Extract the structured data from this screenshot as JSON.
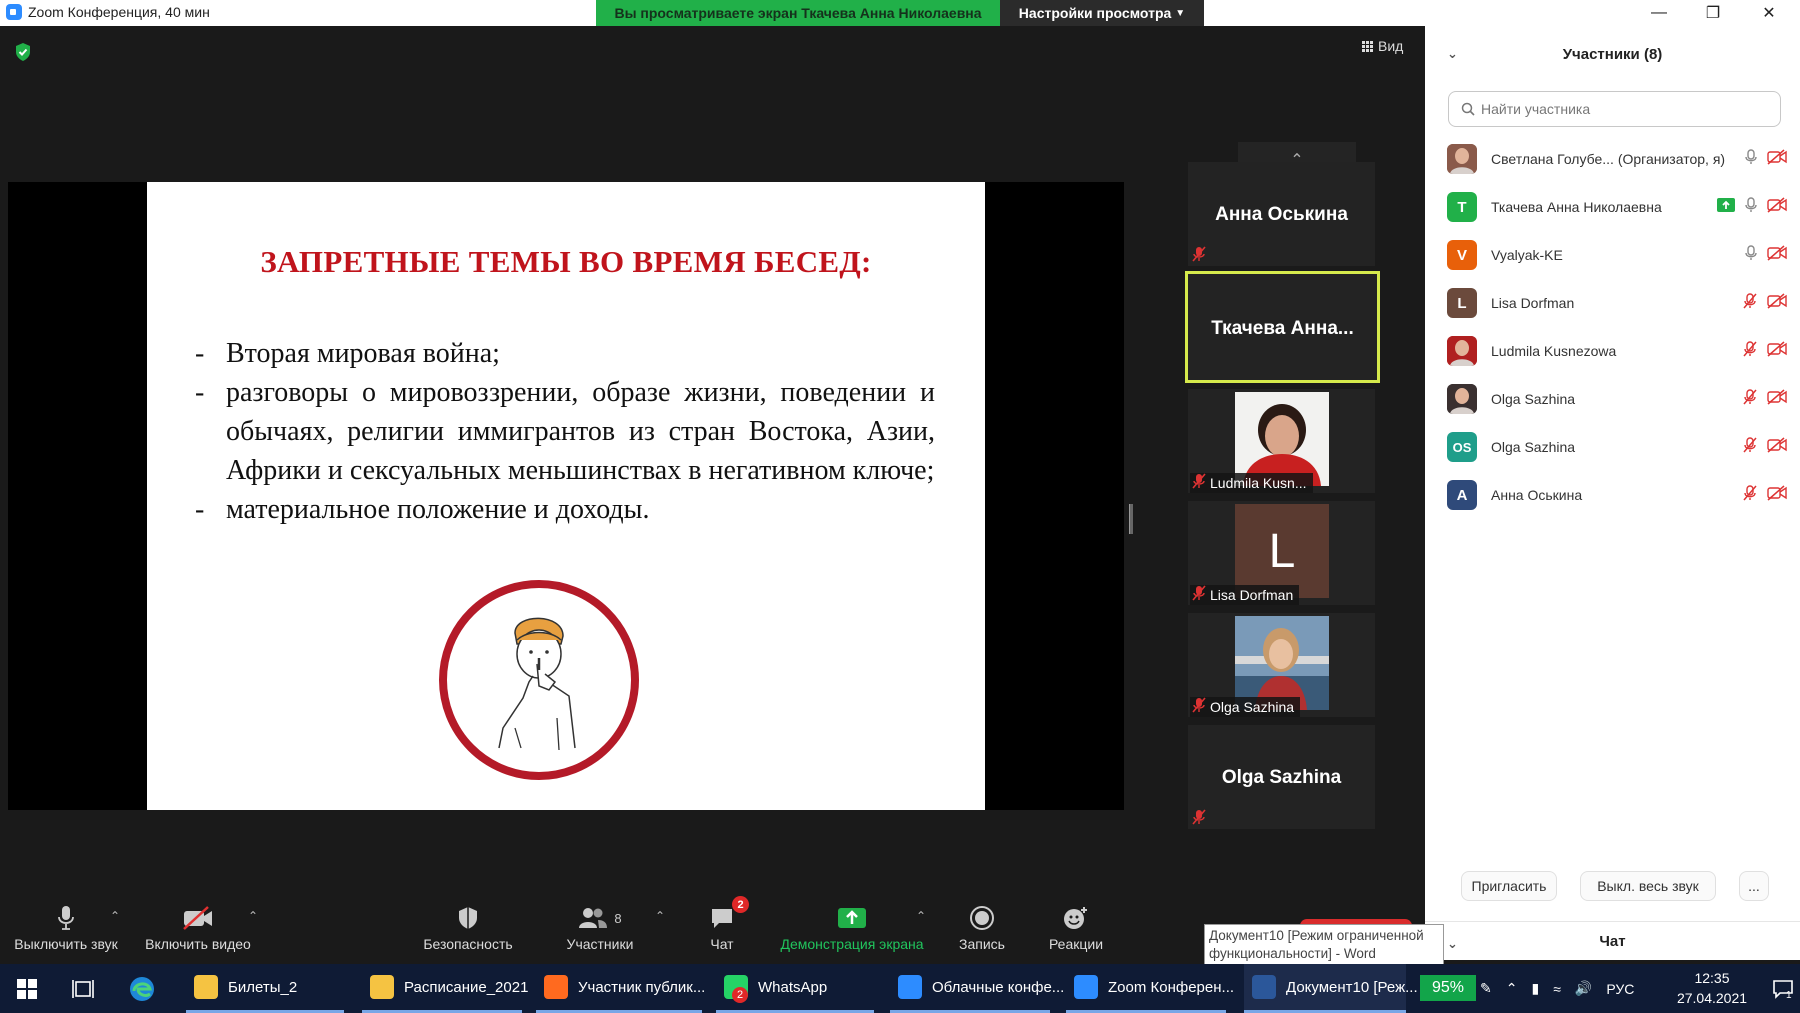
{
  "window": {
    "title": "Zoom Конференция, 40 мин",
    "viewing_banner": "Вы просматриваете экран Ткачева Анна Николаевна",
    "view_settings": "Настройки просмотра",
    "minimize": "—",
    "restore": "❐",
    "close": "✕"
  },
  "main": {
    "view_button": "Вид"
  },
  "slide": {
    "title": "ЗАПРЕТНЫЕ ТЕМЫ ВО ВРЕМЯ БЕСЕД:",
    "bullets": [
      "Вторая мировая война;",
      "разговоры о мировоззрении, образе жизни, поведении и обычаях, религии иммигрантов из стран Востока, Азии, Африки и сексуальных меньшинствах в негативном ключе;",
      "материальное положение и доходы."
    ],
    "dash": "-",
    "title_color": "#c0141c"
  },
  "thumbnails": [
    {
      "name": "Анна Оськина",
      "type": "name"
    },
    {
      "name": "Ткачева Анна...",
      "type": "name",
      "active": true
    },
    {
      "name": "Ludmila Kusn...",
      "type": "photo"
    },
    {
      "name": "Lisa Dorfman",
      "type": "letter",
      "letter": "L"
    },
    {
      "name": "Olga Sazhina",
      "type": "photo"
    },
    {
      "name": "Olga Sazhina",
      "type": "name"
    }
  ],
  "toolbar": {
    "mute": "Выключить звук",
    "video": "Включить видео",
    "security": "Безопасность",
    "participants": "Участники",
    "participants_count": "8",
    "chat": "Чат",
    "chat_badge": "2",
    "share": "Демонстрация экрана",
    "record": "Запись",
    "reactions": "Реакции"
  },
  "panel": {
    "title": "Участники (8)",
    "search_placeholder": "Найти участника",
    "participants": [
      {
        "name": "Светлана Голубе... (Организатор, я)",
        "avatar": "photo",
        "color": "#8a5a4a",
        "mic": "on",
        "video": "off",
        "sharing": false
      },
      {
        "name": "Ткачева Анна Николаевна",
        "avatar": "Т",
        "color": "#21b049",
        "mic": "on",
        "video": "off",
        "sharing": true
      },
      {
        "name": "Vyalyak-KE",
        "avatar": "V",
        "color": "#e8600a",
        "mic": "on",
        "video": "off",
        "sharing": false
      },
      {
        "name": "Lisa Dorfman",
        "avatar": "L",
        "color": "#6b4a3c",
        "mic": "off",
        "video": "off",
        "sharing": false
      },
      {
        "name": "Ludmila Kusnezowa",
        "avatar": "photo",
        "color": "#b02020",
        "mic": "off",
        "video": "off",
        "sharing": false
      },
      {
        "name": "Olga Sazhina",
        "avatar": "photo",
        "color": "#3a3030",
        "mic": "off",
        "video": "off",
        "sharing": false
      },
      {
        "name": "Olga Sazhina",
        "avatar": "OS",
        "color": "#1f9e8a",
        "mic": "off",
        "video": "off",
        "sharing": false
      },
      {
        "name": "Анна Оськина",
        "avatar": "А",
        "color": "#2f4a7a",
        "mic": "off",
        "video": "off",
        "sharing": false
      }
    ],
    "invite": "Пригласить",
    "mute_all": "Выкл. весь звук",
    "more": "...",
    "chat_title": "Чат"
  },
  "tooltip": {
    "line1": "Документ10 [Режим ограниченной",
    "line2": "функциональности] - Word"
  },
  "taskbar": {
    "items": [
      {
        "label": "Билеты_2",
        "color": "#f5c342"
      },
      {
        "label": "Расписание_2021",
        "color": "#f5c342"
      },
      {
        "label": "Участник публик...",
        "color": "#ff6a1f"
      },
      {
        "label": "WhatsApp",
        "color": "#25d366",
        "badge": "2"
      },
      {
        "label": "Облачные конфе...",
        "color": "#2d8cff"
      },
      {
        "label": "Zoom Конферен...",
        "color": "#2d8cff"
      },
      {
        "label": "Документ10 [Реж...",
        "color": "#2b579a"
      }
    ],
    "zoom_level": "95%",
    "language": "РУС",
    "time": "12:35",
    "date": "27.04.2021",
    "notifications": "1"
  }
}
